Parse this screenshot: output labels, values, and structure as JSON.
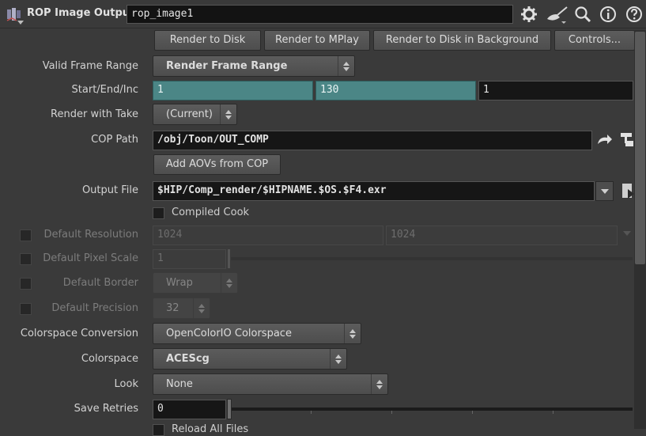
{
  "header": {
    "node_type": "ROP Image Output",
    "node_name": "rop_image1",
    "icons": [
      "rop-node-icon",
      "gear-icon",
      "paint-brush-icon",
      "search-icon",
      "info-icon",
      "help-icon"
    ]
  },
  "buttons": {
    "render_to_disk": "Render to Disk",
    "render_to_mplay": "Render to MPlay",
    "render_bg": "Render to Disk in Background",
    "controls": "Controls..."
  },
  "params": {
    "valid_frame_range": {
      "label": "Valid Frame Range",
      "value": "Render Frame Range"
    },
    "start_end_inc": {
      "label": "Start/End/Inc",
      "start": "1",
      "end": "130",
      "inc": "1"
    },
    "render_with_take": {
      "label": "Render with Take",
      "value": "(Current)"
    },
    "cop_path": {
      "label": "COP Path",
      "value": "/obj/Toon/OUT_COMP"
    },
    "add_aovs": {
      "label": "Add AOVs from COP"
    },
    "output_file": {
      "label": "Output File",
      "value": "$HIP/Comp_render/$HIPNAME.$OS.$F4.exr"
    },
    "compiled_cook": {
      "label": "Compiled Cook",
      "checked": false
    },
    "default_resolution": {
      "label": "Default Resolution",
      "x": "1024",
      "y": "1024",
      "enabled": false
    },
    "default_pixel_scale": {
      "label": "Default Pixel Scale",
      "value": "1",
      "enabled": false
    },
    "default_border": {
      "label": "Default Border",
      "value": "Wrap",
      "enabled": false
    },
    "default_precision": {
      "label": "Default Precision",
      "value": "32",
      "enabled": false
    },
    "colorspace_conversion": {
      "label": "Colorspace Conversion",
      "value": "OpenColorIO Colorspace"
    },
    "colorspace": {
      "label": "Colorspace",
      "value": "ACEScg"
    },
    "look": {
      "label": "Look",
      "value": "None"
    },
    "save_retries": {
      "label": "Save Retries",
      "value": "0"
    },
    "reload_all_files": {
      "label": "Reload All Files"
    }
  },
  "colors": {
    "panel_bg": "#3a3a3a",
    "field_bg": "#161616",
    "teal_field": "#4b8686"
  }
}
